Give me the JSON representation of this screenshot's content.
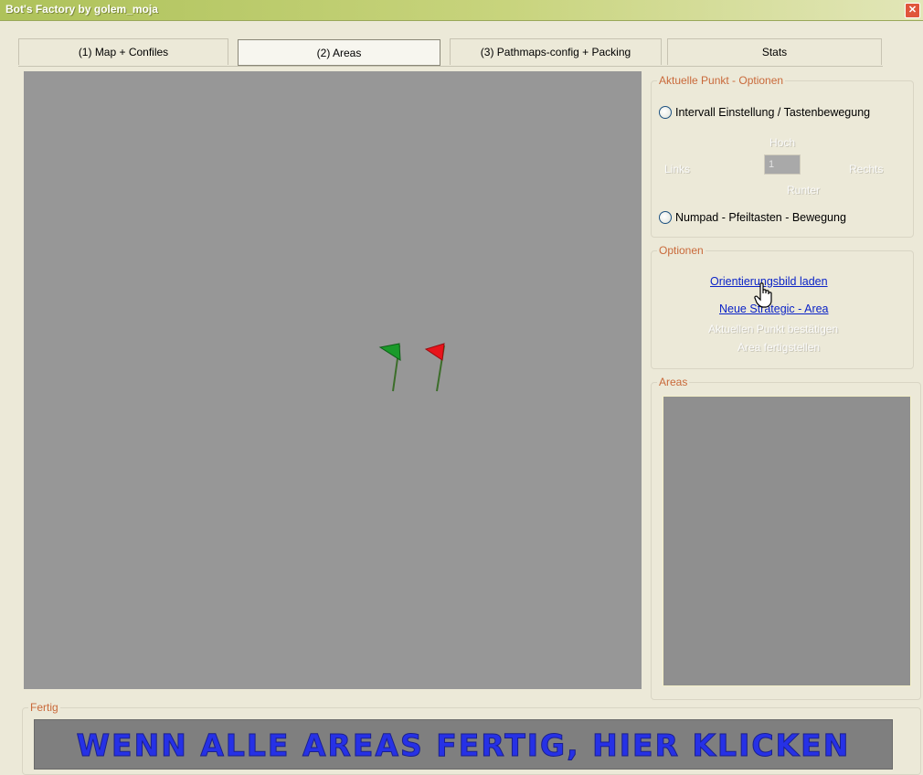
{
  "window": {
    "title": "Bot's Factory by golem_moja",
    "close_glyph": "✕"
  },
  "tabs": [
    {
      "label": "(1) Map + Confiles"
    },
    {
      "label": "(2) Areas"
    },
    {
      "label": "(3) Pathmaps-config + Packing"
    },
    {
      "label": "Stats"
    }
  ],
  "active_tab_index": 1,
  "point_options": {
    "title": "Aktuelle Punkt - Optionen",
    "radio_interval": "Intervall Einstellung / Tastenbewegung",
    "label_up": "Hoch",
    "label_left": "Links",
    "label_right": "Rechts",
    "label_down": "Runter",
    "interval_value": "1",
    "radio_numpad": "Numpad - Pfeiltasten - Bewegung"
  },
  "options": {
    "title": "Optionen",
    "link_load_image": "Orientierungsbild laden",
    "link_new_area": "Neue Strategic - Area",
    "confirm_point": "Aktuellen Punkt bestätigen",
    "finish_area": "Area fertigstellen"
  },
  "areas": {
    "title": "Areas"
  },
  "done": {
    "title": "Fertig",
    "button_label": "WENN ALLE AREAS FERTIG,  HIER KLICKEN"
  },
  "colors": {
    "map_background": "#979797",
    "flag_green": "#1a9a2a",
    "flag_red": "#e8141b",
    "accent_label": "#c9693a",
    "link": "#0b23c7",
    "done_text": "#2631e6"
  },
  "icons": {
    "start_flag": "flag-icon",
    "end_flag": "flag-icon",
    "cursor": "hand-pointer-icon"
  }
}
